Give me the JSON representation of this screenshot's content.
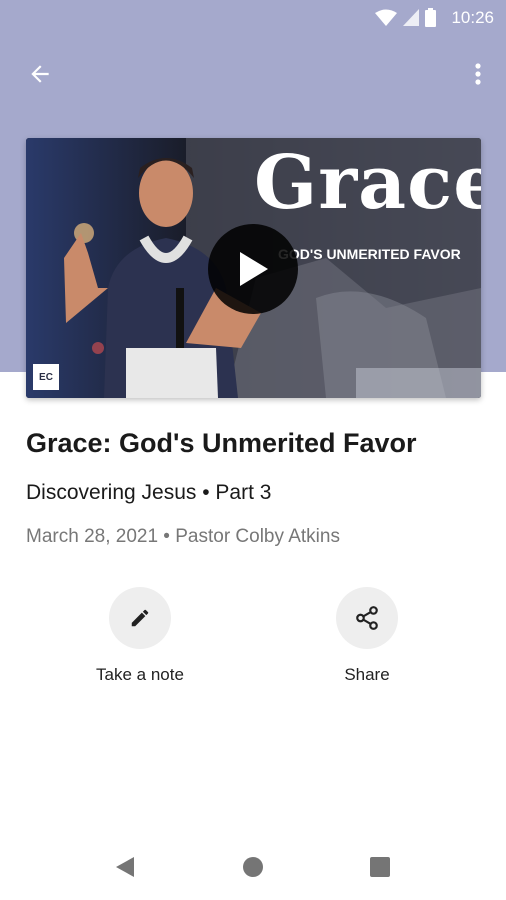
{
  "status_bar": {
    "time": "10:26"
  },
  "video": {
    "overlay_title": "Grace",
    "overlay_subtitle": "GOD'S UNMERITED FAVOR",
    "logo_text": "EC"
  },
  "sermon": {
    "title": "Grace: God's Unmerited Favor",
    "series": "Discovering Jesus • Part 3",
    "meta": "March 28, 2021 • Pastor Colby Atkins"
  },
  "actions": {
    "note_label": "Take a note",
    "share_label": "Share"
  },
  "colors": {
    "header_bg": "#a5a9cc",
    "accent_text": "#1a1a1a",
    "secondary_text": "#777777"
  }
}
